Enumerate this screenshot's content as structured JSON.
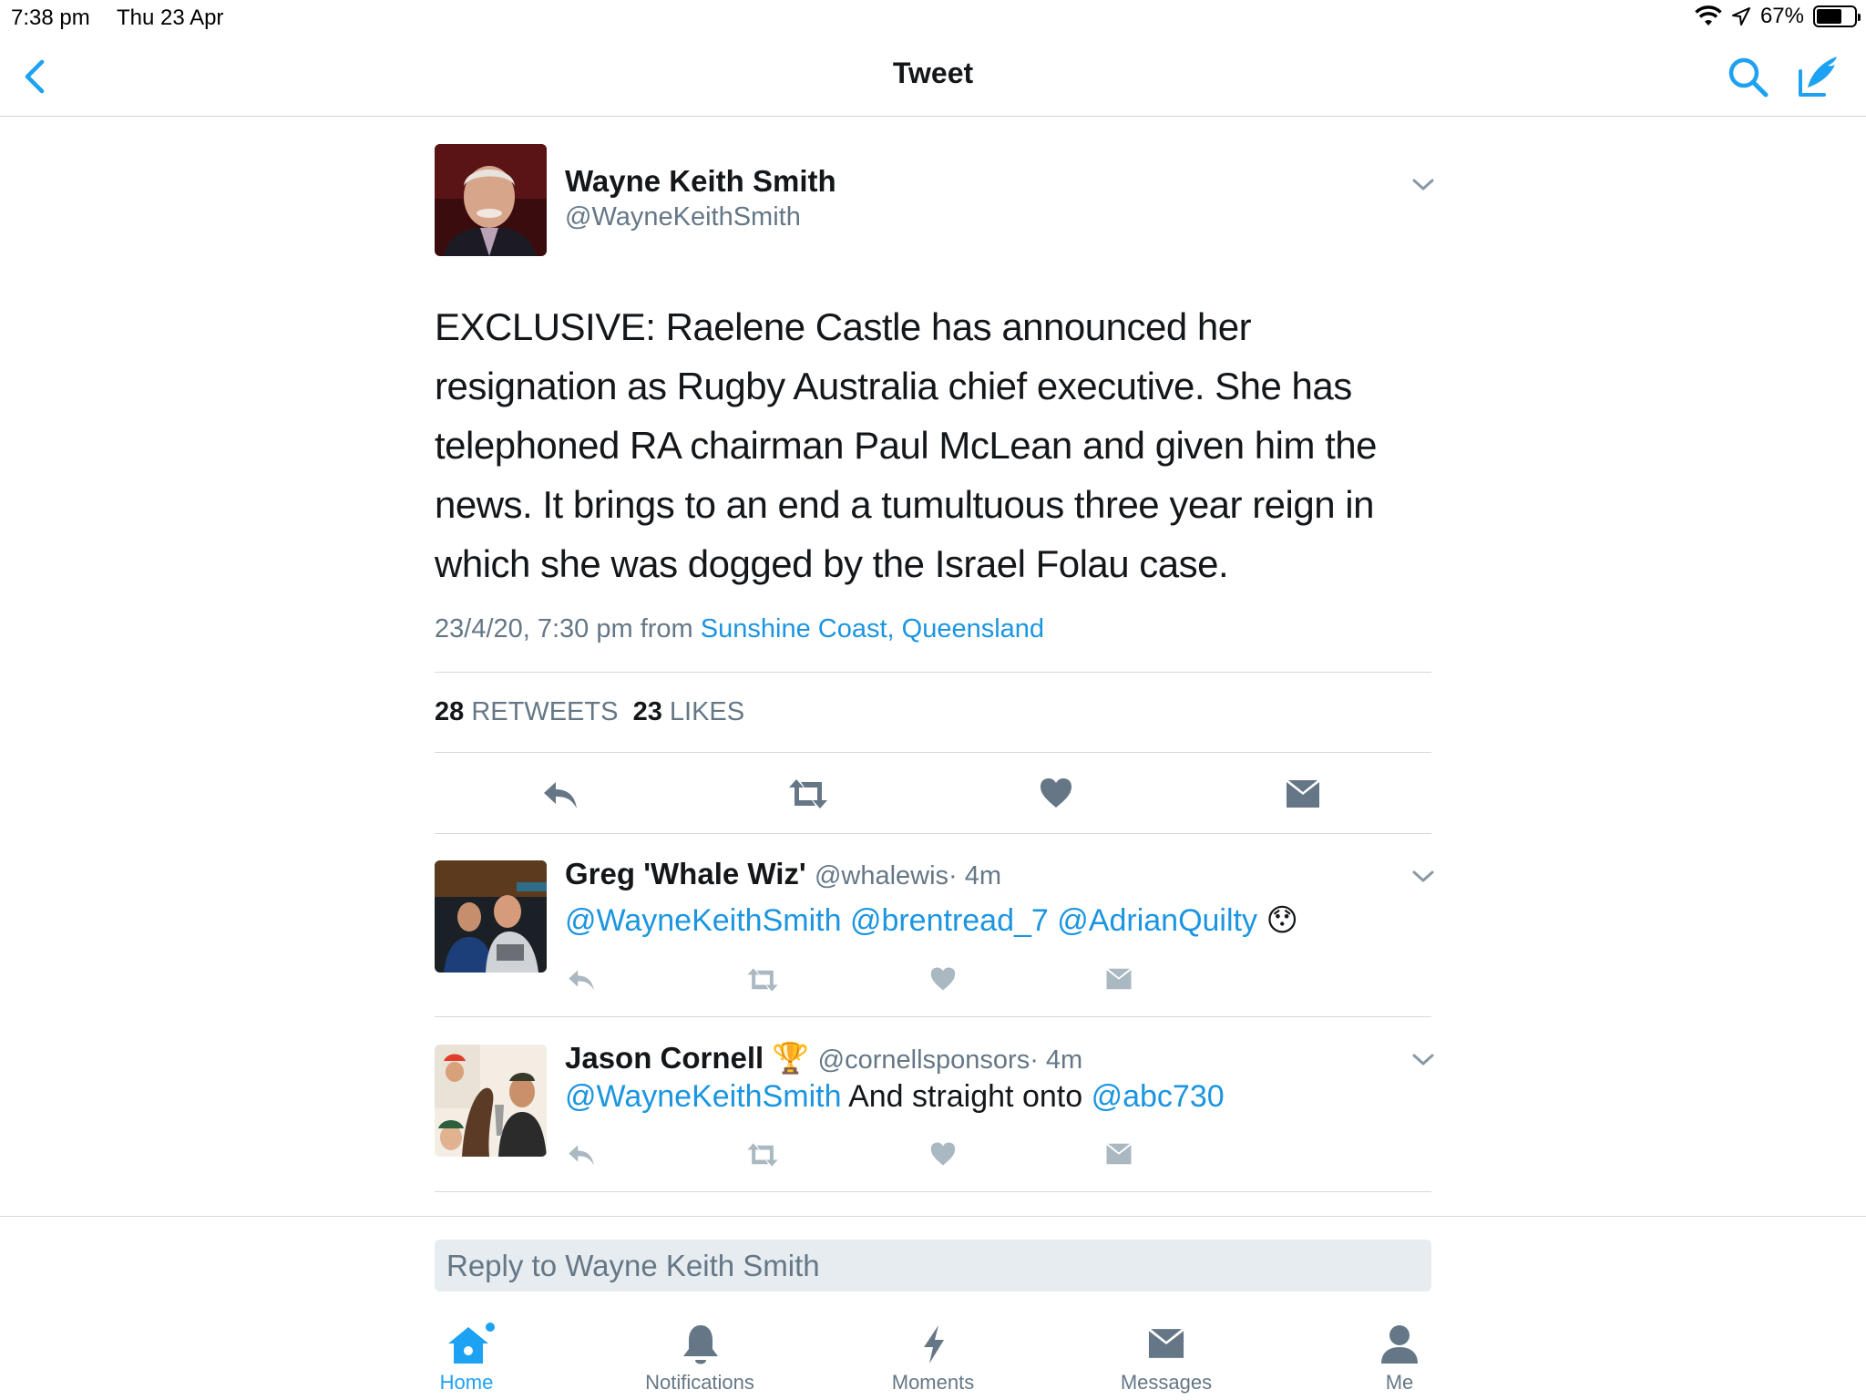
{
  "status_bar": {
    "time": "7:38 pm",
    "date": "Thu 23 Apr",
    "battery": "67%",
    "battery_level": 0.67
  },
  "nav": {
    "title": "Tweet"
  },
  "tweet": {
    "author_name": "Wayne Keith Smith",
    "author_handle": "@WayneKeithSmith",
    "text": "EXCLUSIVE: Raelene Castle has announced her resignation as Rugby Australia chief executive. She has telephoned RA chairman Paul McLean and given him the news. It brings to an end a tumultuous three year reign in which she was dogged by the Israel Folau case.",
    "timestamp": "23/4/20, 7:30 pm",
    "from_label": "from",
    "location": "Sunshine Coast, Queensland",
    "retweets_count": "28",
    "retweets_label": "RETWEETS",
    "likes_count": "23",
    "likes_label": "LIKES"
  },
  "replies": [
    {
      "name": "Greg 'Whale Wiz'",
      "handle": "@whalewis",
      "time": "· 4m",
      "mentions": [
        "@WayneKeithSmith",
        "@brentread_7",
        "@AdrianQuilty"
      ],
      "emoji": "😯"
    },
    {
      "name": "Jason Cornell",
      "badge": "🏆",
      "handle": "@cornellsponsors",
      "time": "· 4m",
      "mention": "@WayneKeithSmith",
      "text": "And straight onto",
      "mention2": "@abc730"
    }
  ],
  "reply_box": {
    "placeholder": "Reply to Wayne Keith Smith"
  },
  "tabs": [
    {
      "label": "Home",
      "icon": "home-icon",
      "active": true
    },
    {
      "label": "Notifications",
      "icon": "bell-icon",
      "active": false
    },
    {
      "label": "Moments",
      "icon": "lightning-icon",
      "active": false
    },
    {
      "label": "Messages",
      "icon": "envelope-icon",
      "active": false
    },
    {
      "label": "Me",
      "icon": "person-icon",
      "active": false
    }
  ],
  "colors": {
    "accent": "#1da1f2",
    "link": "#1b95e0",
    "secondary_text": "#657786",
    "action_icon": "#657786"
  }
}
